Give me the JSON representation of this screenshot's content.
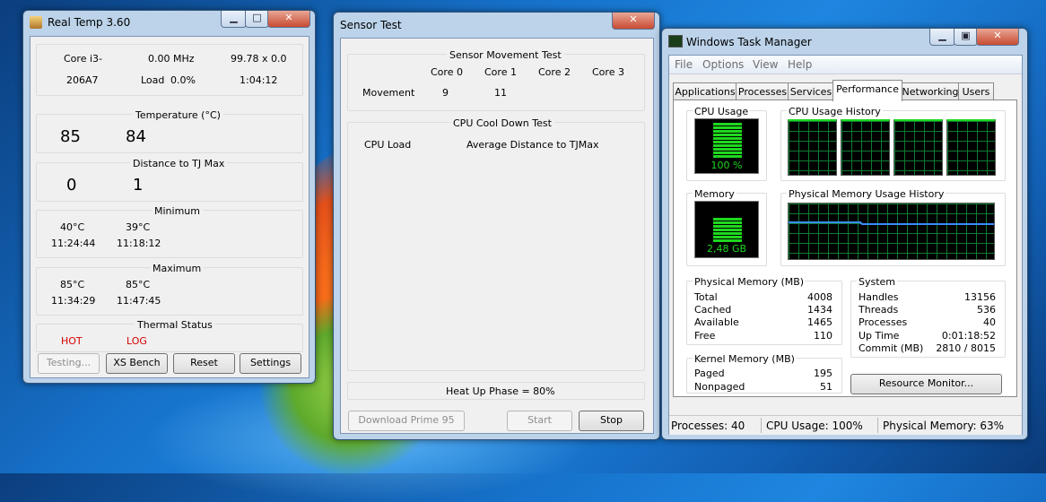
{
  "realtemp": {
    "title": "Real Temp 3.60",
    "cpu_model": "Core i3-",
    "cpu_id": "206A7",
    "mhz": "0.00 MHz",
    "multiplier": "99.78 x 0.0",
    "load_label": "Load",
    "load_value": "0.0%",
    "clock": "1:04:12",
    "temp_header": "Temperature (°C)",
    "temps": [
      "85",
      "84"
    ],
    "dist_header": "Distance to TJ Max",
    "dists": [
      "0",
      "1"
    ],
    "min_header": "Minimum",
    "min_temps": [
      "40°C",
      "39°C"
    ],
    "min_times": [
      "11:24:44",
      "11:18:12"
    ],
    "max_header": "Maximum",
    "max_temps": [
      "85°C",
      "85°C"
    ],
    "max_times": [
      "11:34:29",
      "11:47:45"
    ],
    "thermal_header": "Thermal Status",
    "thermal": [
      "HOT",
      "LOG"
    ],
    "buttons": {
      "testing": "Testing...",
      "xs_bench": "XS Bench",
      "reset": "Reset",
      "settings": "Settings"
    }
  },
  "sensor": {
    "title": "Sensor Test",
    "movement_header": "Sensor Movement Test",
    "cores": [
      "Core 0",
      "Core 1",
      "Core 2",
      "Core 3"
    ],
    "movement_label": "Movement",
    "movement_values": [
      "9",
      "11"
    ],
    "cooldown_header": "CPU Cool Down Test",
    "cpu_load_label": "CPU Load",
    "avg_dist_label": "Average Distance to TJMax",
    "phase": "Heat Up Phase = 80%",
    "buttons": {
      "download": "Download Prime 95",
      "start": "Start",
      "stop": "Stop"
    }
  },
  "taskmgr": {
    "title": "Windows Task Manager",
    "menu": [
      "File",
      "Options",
      "View",
      "Help"
    ],
    "tabs": [
      "Applications",
      "Processes",
      "Services",
      "Performance",
      "Networking",
      "Users"
    ],
    "active_tab": "Performance",
    "cpu_usage_label": "CPU Usage",
    "cpu_usage_value": "100 %",
    "cpu_usage_fraction": 1.0,
    "cpu_history_label": "CPU Usage History",
    "memory_label": "Memory",
    "memory_value": "2,48 GB",
    "memory_fraction": 0.63,
    "phys_history_label": "Physical Memory Usage History",
    "phys_mem": {
      "header": "Physical Memory (MB)",
      "rows": [
        [
          "Total",
          "4008"
        ],
        [
          "Cached",
          "1434"
        ],
        [
          "Available",
          "1465"
        ],
        [
          "Free",
          "110"
        ]
      ]
    },
    "kernel_mem": {
      "header": "Kernel Memory (MB)",
      "rows": [
        [
          "Paged",
          "195"
        ],
        [
          "Nonpaged",
          "51"
        ]
      ]
    },
    "system": {
      "header": "System",
      "rows": [
        [
          "Handles",
          "13156"
        ],
        [
          "Threads",
          "536"
        ],
        [
          "Processes",
          "40"
        ],
        [
          "Up Time",
          "0:01:18:52"
        ],
        [
          "Commit (MB)",
          "2810 / 8015"
        ]
      ]
    },
    "resource_monitor": "Resource Monitor...",
    "status": {
      "processes": "Processes: 40",
      "cpu": "CPU Usage: 100%",
      "memory": "Physical Memory: 63%"
    }
  },
  "colors": {
    "graph_green": "#1fd81f",
    "graph_grid": "#0f7a31",
    "hot_red": "#d40000",
    "history_line": "#3b8cff"
  }
}
